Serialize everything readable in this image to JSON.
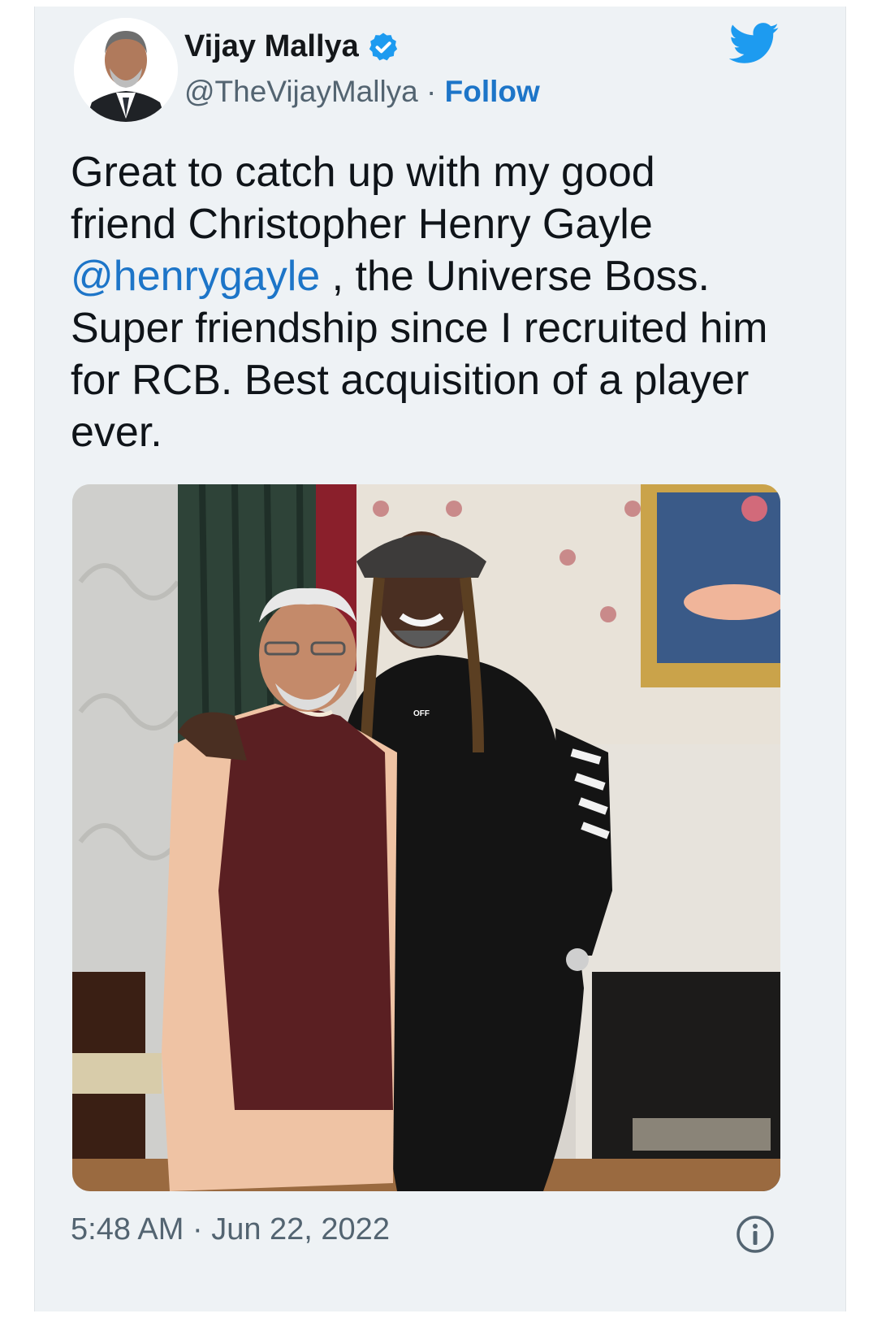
{
  "author": {
    "name": "Vijay Mallya",
    "handle": "@TheVijayMallya",
    "separator": "·",
    "follow_label": "Follow",
    "verified": true,
    "avatar_icon": "profile-photo"
  },
  "tweet": {
    "text_before": "Great to catch up with my good friend Christopher Henry Gayle ",
    "mention": "@henrygayle",
    "text_after": " , the Universe Boss. Super friendship since I recruited him for RCB. Best acquisition of a player ever."
  },
  "media": {
    "print_text": "OFF"
  },
  "footer": {
    "time": "5:48 AM",
    "separator": "·",
    "date": "Jun 22, 2022",
    "info_icon": "info-icon"
  },
  "colors": {
    "background": "#eef2f5",
    "link": "#1d75c8",
    "twitter_blue": "#1d9bf0",
    "text": "#0f1419",
    "muted": "#536471"
  }
}
